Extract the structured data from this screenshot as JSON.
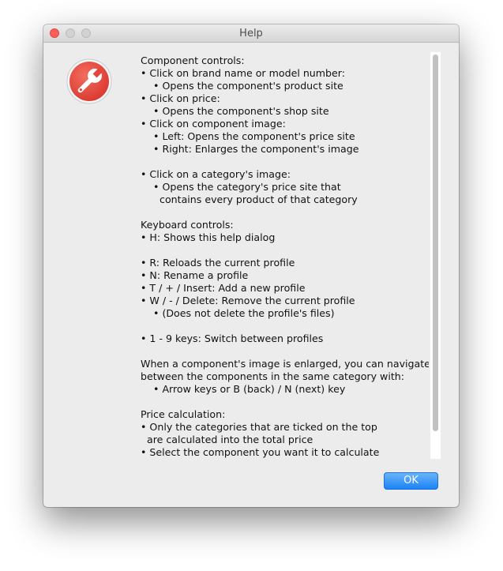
{
  "window": {
    "title": "Help"
  },
  "icon": {
    "name": "wrench-icon",
    "color": "#e8473c"
  },
  "help_lines": [
    "Component controls:",
    "• Click on brand name or model number:",
    "    • Opens the component's product site",
    "• Click on price:",
    "    • Opens the component's shop site",
    "• Click on component image:",
    "    • Left: Opens the component's price site",
    "    • Right: Enlarges the component's image",
    "",
    "• Click on a category's image:",
    "    • Opens the category's price site that",
    "      contains every product of that category",
    "",
    "Keyboard controls:",
    "• H: Shows this help dialog",
    "",
    "• R: Reloads the current profile",
    "• N: Rename a profile",
    "• T / + / Insert: Add a new profile",
    "• W / - / Delete: Remove the current profile",
    "    • (Does not delete the profile's files)",
    "",
    "• 1 - 9 keys: Switch between profiles",
    "",
    "When a component's image is enlarged, you can navigate",
    "between the components in the same category with:",
    "    • Arrow keys or B (back) / N (next) key",
    "",
    "Price calculation:",
    "• Only the categories that are ticked on the top",
    "  are calculated into the total price",
    "• Select the component you want it to calculate"
  ],
  "buttons": {
    "ok_label": "OK"
  },
  "colors": {
    "accent": "#1b83f5",
    "window_bg": "#ececec"
  }
}
